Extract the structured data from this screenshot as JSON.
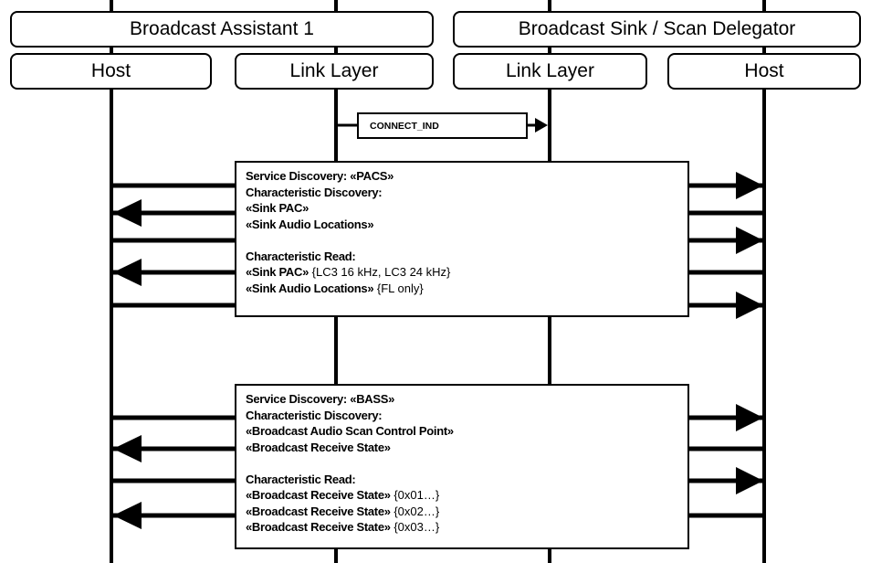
{
  "groups": {
    "assistant": "Broadcast Assistant 1",
    "sink": "Broadcast Sink / Scan Delegator"
  },
  "lifelines": [
    {
      "id": "assistant-host",
      "label": "Host"
    },
    {
      "id": "assistant-ll",
      "label": "Link Layer"
    },
    {
      "id": "sink-ll",
      "label": "Link Layer"
    },
    {
      "id": "sink-host",
      "label": "Host"
    }
  ],
  "connect_msg": {
    "label": "CONNECT_IND",
    "from": "assistant-ll",
    "to": "sink-ll"
  },
  "pacs_box": {
    "lines": [
      {
        "bold": "Service Discovery: «PACS»",
        "normal": ""
      },
      {
        "bold": "Characteristic Discovery:",
        "normal": ""
      },
      {
        "bold": "«Sink PAC»",
        "normal": ""
      },
      {
        "bold": "«Sink Audio Locations»",
        "normal": ""
      },
      {
        "bold": "",
        "normal": ""
      },
      {
        "bold": "Characteristic Read:",
        "normal": ""
      },
      {
        "bold": "«Sink PAC»",
        "normal": " {LC3 16 kHz, LC3 24 kHz}"
      },
      {
        "bold": "«Sink Audio Locations»",
        "normal": " {FL only}"
      }
    ],
    "arrows": [
      "to-sink",
      "to-assistant",
      "to-sink",
      "to-assistant",
      "to-sink"
    ]
  },
  "bass_box": {
    "lines": [
      {
        "bold": "Service Discovery: «BASS»",
        "normal": ""
      },
      {
        "bold": "Characteristic Discovery:",
        "normal": ""
      },
      {
        "bold": "«Broadcast Audio Scan Control Point»",
        "normal": ""
      },
      {
        "bold": "«Broadcast Receive State»",
        "normal": ""
      },
      {
        "bold": "",
        "normal": ""
      },
      {
        "bold": "Characteristic Read:",
        "normal": ""
      },
      {
        "bold": "«Broadcast Receive State»",
        "normal": " {0x01…}"
      },
      {
        "bold": "«Broadcast Receive State»",
        "normal": " {0x02…}"
      },
      {
        "bold": "«Broadcast Receive State»",
        "normal": " {0x03…}"
      }
    ],
    "arrows": [
      "to-sink",
      "to-assistant",
      "to-sink",
      "to-assistant"
    ]
  }
}
